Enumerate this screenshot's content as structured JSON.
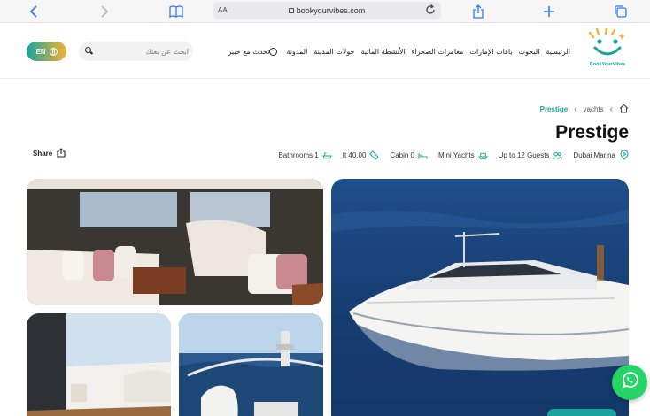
{
  "browser": {
    "reader_label": "AA",
    "url": "bookyourvibes.com"
  },
  "header": {
    "lang_label": "EN",
    "search_placeholder": "ابحث عن بغتك",
    "nav_items": [
      "الرئيسية",
      "اليخوت",
      "باقات الإمارات",
      "مغامرات الصحراء",
      "الأنشطة المائية",
      "جولات المدينة",
      "المدونة",
      "تحدث مع خبير"
    ],
    "logo_text": "BookYourVibes"
  },
  "breadcrumb": {
    "home_icon": "home-icon",
    "section": "yachts",
    "current": "Prestige"
  },
  "title": "Prestige",
  "share_label": "Share",
  "features": [
    {
      "label": "Dubai Marina",
      "icon": "location-pin-icon"
    },
    {
      "label": "Up to 12 Guests",
      "icon": "guests-icon"
    },
    {
      "label": "Mini Yachts",
      "icon": "yacht-icon"
    },
    {
      "label": "Cabin 0",
      "icon": "bed-icon"
    },
    {
      "label": "ft 40.00",
      "icon": "ruler-icon"
    },
    {
      "label": "Bathrooms 1",
      "icon": "bathtub-icon"
    }
  ],
  "colors": {
    "brand_teal": "#1aa39a",
    "brand_orange": "#f2b233",
    "whatsapp": "#25d366"
  }
}
